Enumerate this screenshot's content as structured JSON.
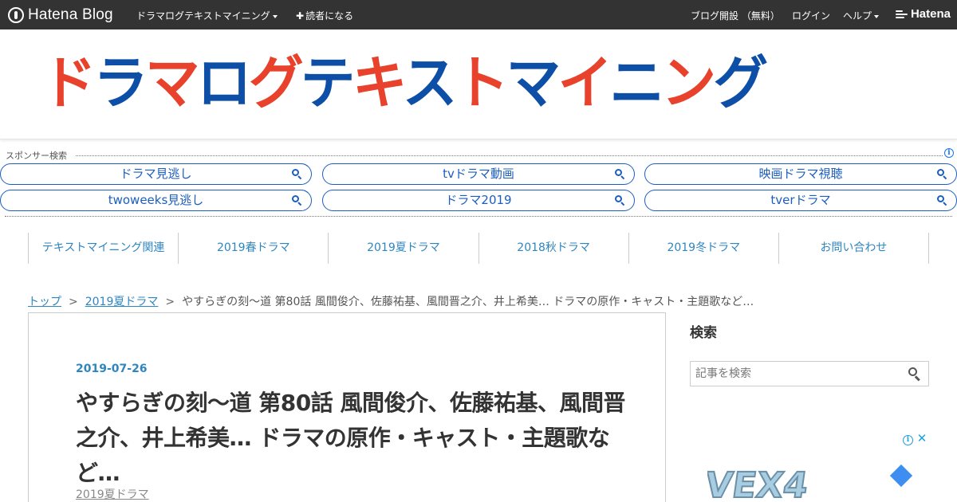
{
  "topbar": {
    "brand": "Hatena Blog",
    "blog_menu": "ドラマログテキストマイニング",
    "subscribe": "読者になる",
    "open_blog": "ブログ開設 （無料）",
    "login": "ログイン",
    "help": "ヘルプ",
    "hatena": "Hatena"
  },
  "header": {
    "banner_chars": [
      "ド",
      "ラ",
      "マ",
      "ロ",
      "グ",
      "テ",
      "キ",
      "ス",
      "ト",
      "マ",
      "イ",
      "ニ",
      "ン",
      "グ"
    ]
  },
  "sponsor": {
    "label": "スポンサー検索",
    "info": "i",
    "links": [
      "ドラマ見逃し",
      "tvドラマ動画",
      "映画ドラマ視聴",
      "twoweeks見逃し",
      "ドラマ2019",
      "tverドラマ"
    ]
  },
  "nav": {
    "items": [
      "テキストマイニング関連",
      "2019春ドラマ",
      "2019夏ドラマ",
      "2018秋ドラマ",
      "2019冬ドラマ",
      "お問い合わせ"
    ]
  },
  "breadcrumb": {
    "top": "トップ",
    "separator": ">",
    "category": "2019夏ドラマ",
    "current": "やすらぎの刻～道 第80話 風間俊介、佐藤祐基、風間晋之介、井上希美… ドラマの原作・キャスト・主題歌など…"
  },
  "article": {
    "date": "2019-07-26",
    "title": "やすらぎの刻～道 第80話 風間俊介、佐藤祐基、風間晋之介、井上希美… ドラマの原作・キャスト・主題歌など…",
    "category": "2019夏ドラマ"
  },
  "sidebar": {
    "search_heading": "検索",
    "search_placeholder": "記事を検索"
  },
  "ad": {
    "info": "i",
    "close": "✕",
    "brand": "VEX4"
  },
  "colors": {
    "topbar_bg": "#333333",
    "banner_red": "#e8412c",
    "banner_blue": "#0d4fa6",
    "link_blue": "#2e86c1",
    "pill_blue": "#1c5ec0"
  }
}
